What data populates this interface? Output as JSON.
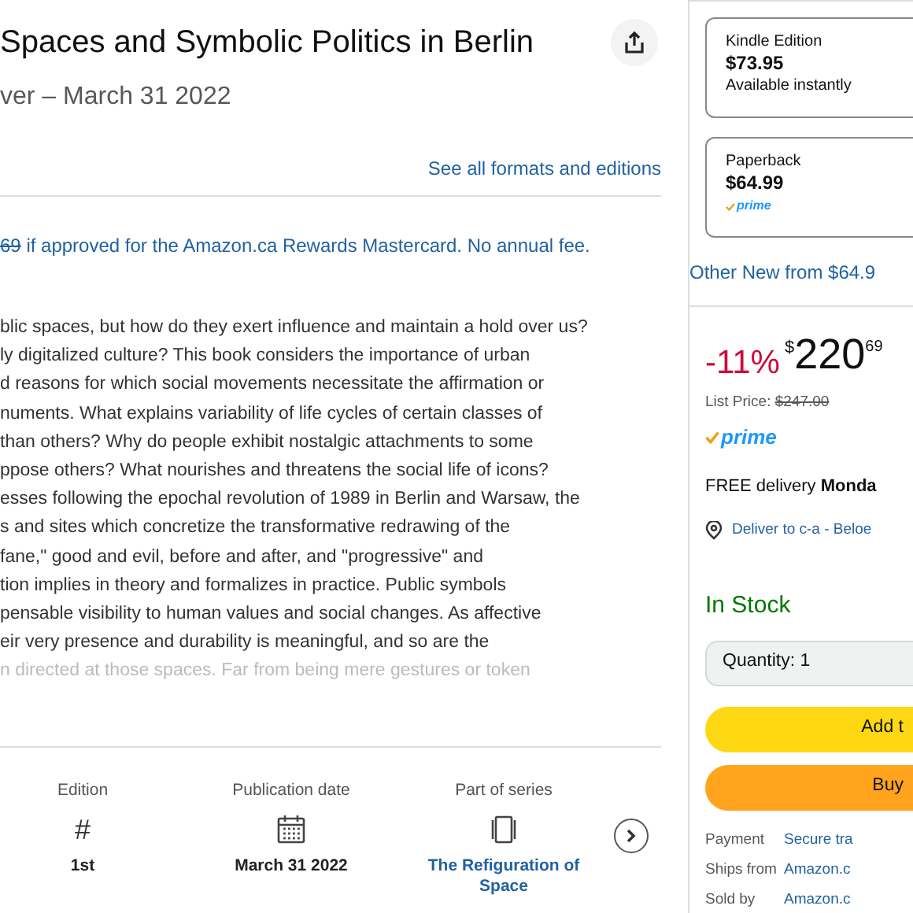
{
  "title": "Spaces and Symbolic Politics in Berlin",
  "subtitle": "ver – March 31 2022",
  "formats_link": "See all formats and editions",
  "rewards": {
    "old_price": "69",
    "text": "if approved for the Amazon.ca Rewards Mastercard. No annual fee."
  },
  "description": [
    "blic spaces, but how do they exert influence and maintain a hold over us?",
    "ly digitalized culture? This book considers the importance of urban",
    "d reasons for which social movements necessitate the affirmation or",
    "numents. What explains variability of life cycles of certain classes of",
    "than others? Why do people exhibit nostalgic attachments to some",
    "ppose others? What nourishes and threatens the social life of icons?",
    "esses following the epochal revolution of 1989 in Berlin and Warsaw, the",
    "s and sites which concretize the transformative redrawing of the",
    "fane,\" good and evil, before and after, and \"progressive\" and",
    "tion implies in theory and formalizes in practice. Public symbols",
    "pensable visibility to human values and social changes. As affective",
    "eir very presence and durability is meaningful, and so are the",
    "n directed at those spaces. Far from being mere gestures or token"
  ],
  "details": [
    {
      "kind": "hash",
      "label": "Edition",
      "glyph": "#",
      "value": "1st",
      "link": false
    },
    {
      "kind": "calendar",
      "label": "Publication date",
      "value": "March 31 2022",
      "link": false
    },
    {
      "kind": "book",
      "label": "Part of series",
      "value": "The Refiguration of Space",
      "link": true
    }
  ],
  "formats": [
    {
      "name": "Kindle Edition",
      "price": "$73.95",
      "note": "Available instantly",
      "prime": false
    },
    {
      "name": "Paperback",
      "price": "$64.99",
      "note": "prime",
      "prime": true
    }
  ],
  "other_new": "Other New from $64.9",
  "discount": "-11%",
  "price_symbol": "$",
  "price_whole": "220",
  "price_fraction": "69",
  "list_price_label": "List Price:",
  "list_price": "$247.00",
  "prime": "prime",
  "delivery": {
    "prefix": "FREE delivery",
    "day": "Monda"
  },
  "deliver_to": "Deliver to c-a - Beloe",
  "stock": "In Stock",
  "quantity": "Quantity: 1",
  "buttons": [
    {
      "kind": "cart",
      "label": "Add t"
    },
    {
      "kind": "buy",
      "label": "Buy"
    }
  ],
  "info": [
    {
      "label": "Payment",
      "value": "Secure tra"
    },
    {
      "label": "Ships from",
      "value": "Amazon.c"
    },
    {
      "label": "Sold by",
      "value": "Amazon.c"
    }
  ]
}
